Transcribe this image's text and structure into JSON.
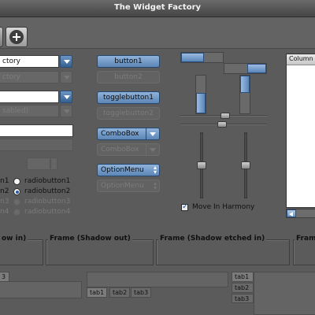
{
  "window": {
    "title": "The Widget Factory"
  },
  "toolbar": {
    "add_icon": "plus-circle-icon"
  },
  "combos": {
    "combo1_text": "ctory",
    "combo2_text": "ctory",
    "combo3_text": "",
    "combo4_text": "sabled)"
  },
  "buttons": {
    "button1": "button1",
    "button2": "button2",
    "togglebutton1": "togglebutton1",
    "togglebutton2": "togglebutton2",
    "combobox1": "ComboBox",
    "combobox2": "ComboBox",
    "optionmenu1": "OptionMenu",
    "optionmenu2": "OptionMenu"
  },
  "radios": [
    {
      "label": "radiobutton1",
      "prefix": "n1",
      "selected": false,
      "disabled": false
    },
    {
      "label": "radiobutton2",
      "prefix": "n2",
      "selected": true,
      "disabled": false
    },
    {
      "label": "radiobutton3",
      "prefix": "n3",
      "selected": false,
      "disabled": true
    },
    {
      "label": "radiobutton4",
      "prefix": "n4",
      "selected": true,
      "disabled": true
    }
  ],
  "progress": {
    "horizontal1": 0.55,
    "horizontal2": 0.45,
    "vertical1": 0.55,
    "vertical2": 0.45
  },
  "sliders": {
    "move_in_harmony_label": "Move In Harmony",
    "move_in_harmony_checked": true
  },
  "list": {
    "column_header": "Column"
  },
  "frames": {
    "shadow_in": "ow in)",
    "shadow_out": "Frame (Shadow out)",
    "shadow_etched_in": "Frame (Shadow etched in)",
    "shadow_etched_out": "Fram"
  },
  "notebooks": {
    "left_tabs": [
      "3"
    ],
    "bottom_tabs": [
      "tab1",
      "tab2",
      "tab3"
    ],
    "right_tabs": [
      "tab1",
      "tab2",
      "tab3"
    ]
  },
  "colors": {
    "accent": "#5c86b6",
    "background": "#5b5b5b"
  }
}
